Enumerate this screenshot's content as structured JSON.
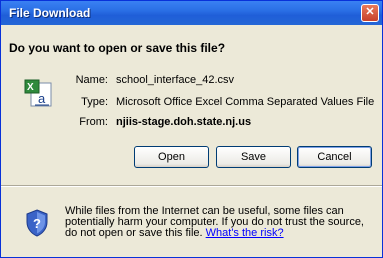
{
  "window": {
    "title": "File Download",
    "close_glyph": "✕"
  },
  "question": "Do you want to open or save this file?",
  "file": {
    "icon": "excel-csv-file-icon",
    "name_label": "Name:",
    "name_value": "school_interface_42.csv",
    "type_label": "Type:",
    "type_value": "Microsoft Office Excel Comma Separated Values File",
    "from_label": "From:",
    "from_value": "njiis-stage.doh.state.nj.us"
  },
  "buttons": {
    "open": "Open",
    "save": "Save",
    "cancel": "Cancel"
  },
  "warning": {
    "icon": "shield-question-icon",
    "text": "While files from the Internet can be useful, some files can potentially harm your computer. If you do not trust the source, do not open or save this file. ",
    "link": "What's the risk?"
  },
  "colors": {
    "titlebar": "#2a6fe5",
    "dialog_bg": "#ece9d8",
    "link": "#0000ff"
  }
}
